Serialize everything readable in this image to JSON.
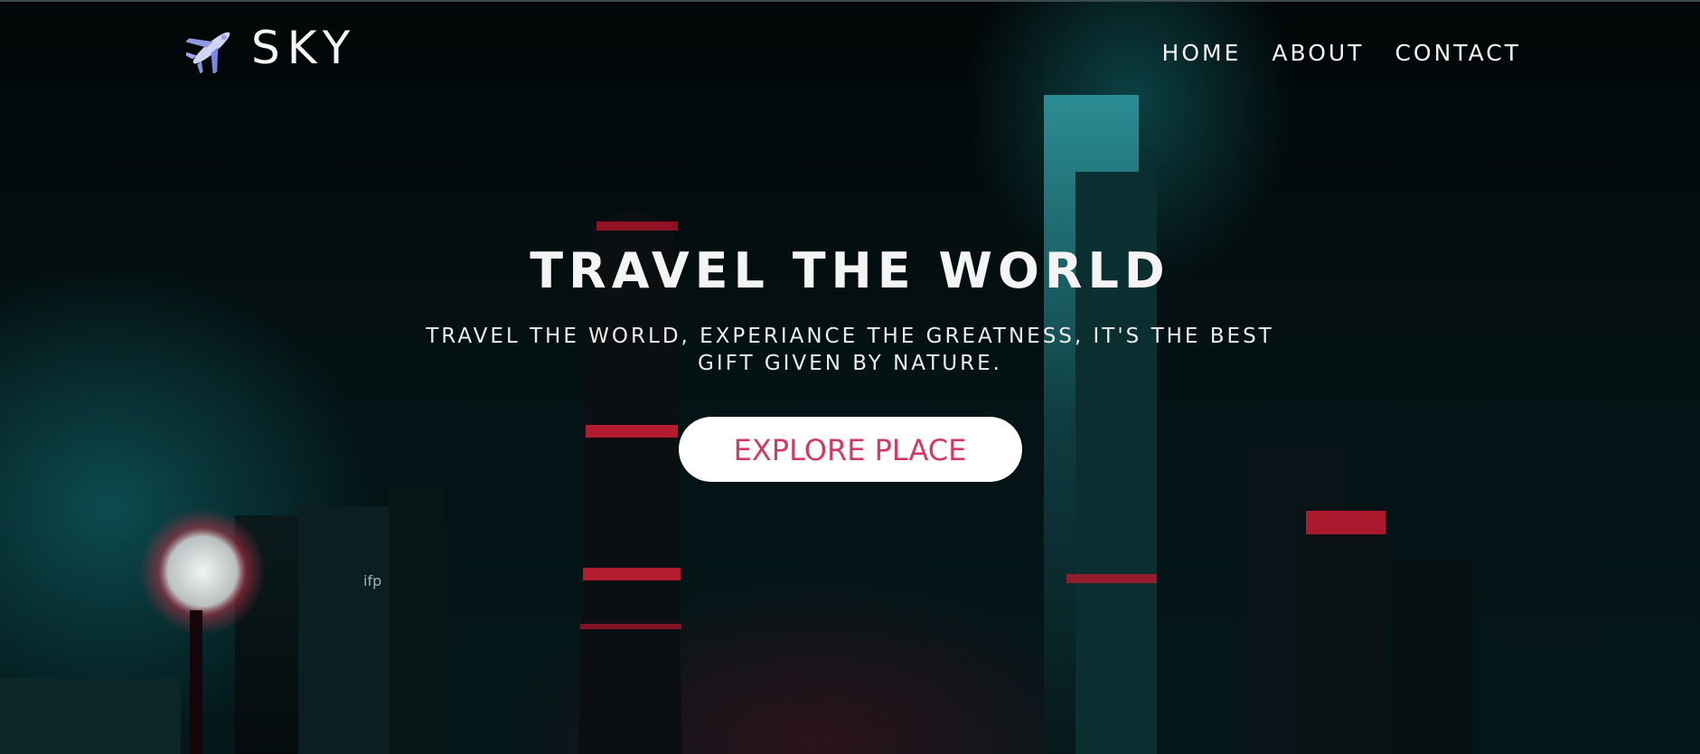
{
  "brand": {
    "name": "SKY",
    "icon": "airplane-icon"
  },
  "nav": {
    "items": [
      {
        "label": "HOME"
      },
      {
        "label": "ABOUT"
      },
      {
        "label": "CONTACT"
      }
    ]
  },
  "hero": {
    "title": "TRAVEL THE WORLD",
    "subtitle": "TRAVEL THE WORLD, EXPERIANCE THE GREATNESS, IT'S THE BEST GIFT GIVEN BY NATURE.",
    "cta_label": "EXPLORE PLACE",
    "background": "night-city-skyline-image"
  },
  "colors": {
    "cta_text": "#d23a64",
    "cta_bg": "#ffffff",
    "accent_teal": "#1aa7ad",
    "accent_red": "#e0243e"
  }
}
